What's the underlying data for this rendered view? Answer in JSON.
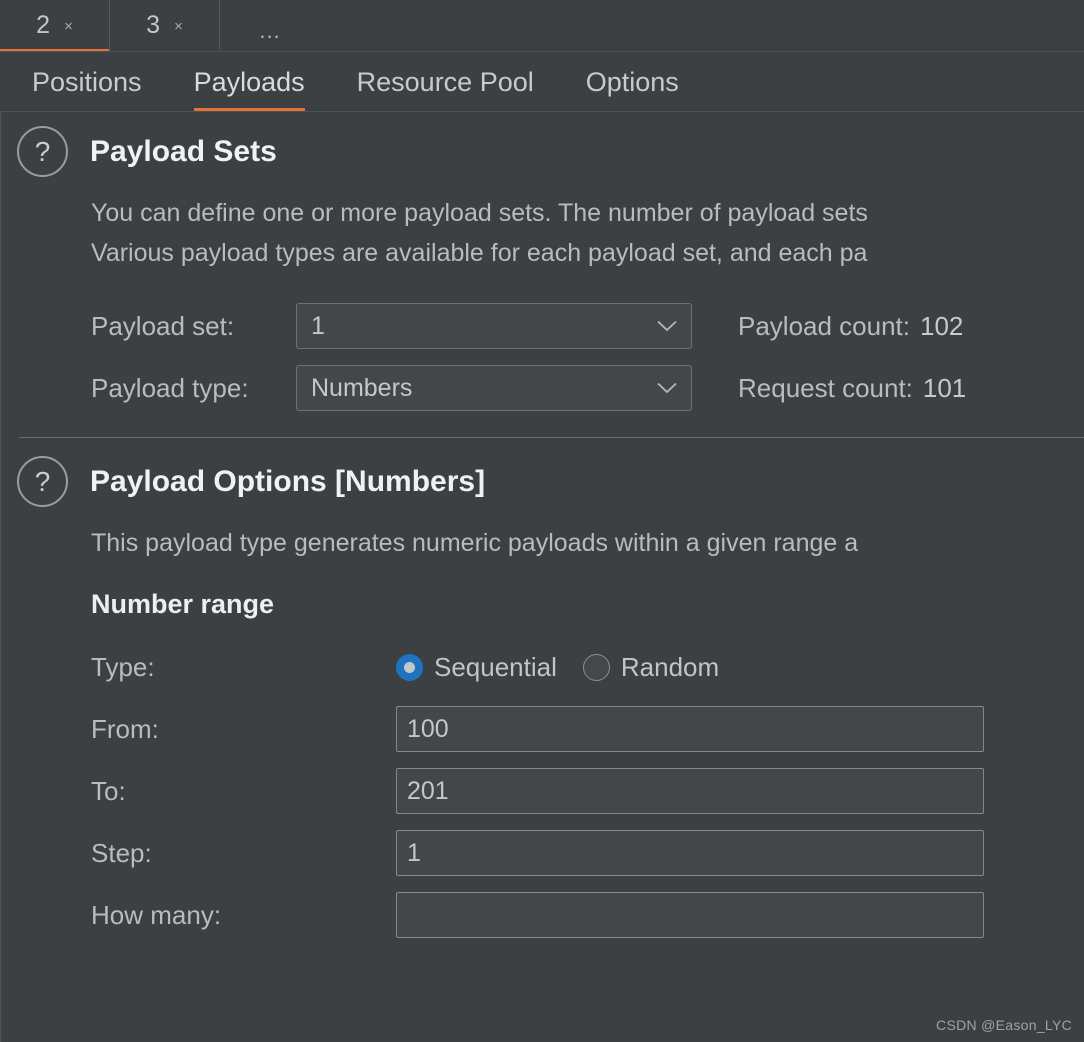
{
  "attack_tabs": {
    "items": [
      {
        "label": "2",
        "close": "×",
        "active": true
      },
      {
        "label": "3",
        "close": "×",
        "active": false
      }
    ],
    "overflow_label": "..."
  },
  "main_tabs": [
    {
      "label": "Positions",
      "active": false
    },
    {
      "label": "Payloads",
      "active": true
    },
    {
      "label": "Resource Pool",
      "active": false
    },
    {
      "label": "Options",
      "active": false
    }
  ],
  "payload_sets": {
    "help_glyph": "?",
    "title": "Payload Sets",
    "description_line1": "You can define one or more payload sets. The number of payload sets",
    "description_line2": "Various payload types are available for each payload set, and each pa",
    "payload_set_label": "Payload set:",
    "payload_set_value": "1",
    "payload_type_label": "Payload type:",
    "payload_type_value": "Numbers",
    "payload_count_label": "Payload count:",
    "payload_count_value": "102",
    "request_count_label": "Request count:",
    "request_count_value": "101"
  },
  "payload_options": {
    "help_glyph": "?",
    "title": "Payload Options [Numbers]",
    "description": "This payload type generates numeric payloads within a given range a",
    "number_range_label": "Number range",
    "type_label": "Type:",
    "type_options": [
      {
        "label": "Sequential",
        "checked": true
      },
      {
        "label": "Random",
        "checked": false
      }
    ],
    "from_label": "From:",
    "from_value": "100",
    "to_label": "To:",
    "to_value": "201",
    "step_label": "Step:",
    "step_value": "1",
    "how_many_label": "How many:",
    "how_many_value": ""
  },
  "watermark": "CSDN @Eason_LYC",
  "colors": {
    "background": "#3c4043",
    "accent": "#e8703a",
    "radio_selected": "#1f73c0",
    "field_background": "#43474a",
    "text_primary": "#eceef0",
    "text_secondary": "#b9bcbe"
  }
}
